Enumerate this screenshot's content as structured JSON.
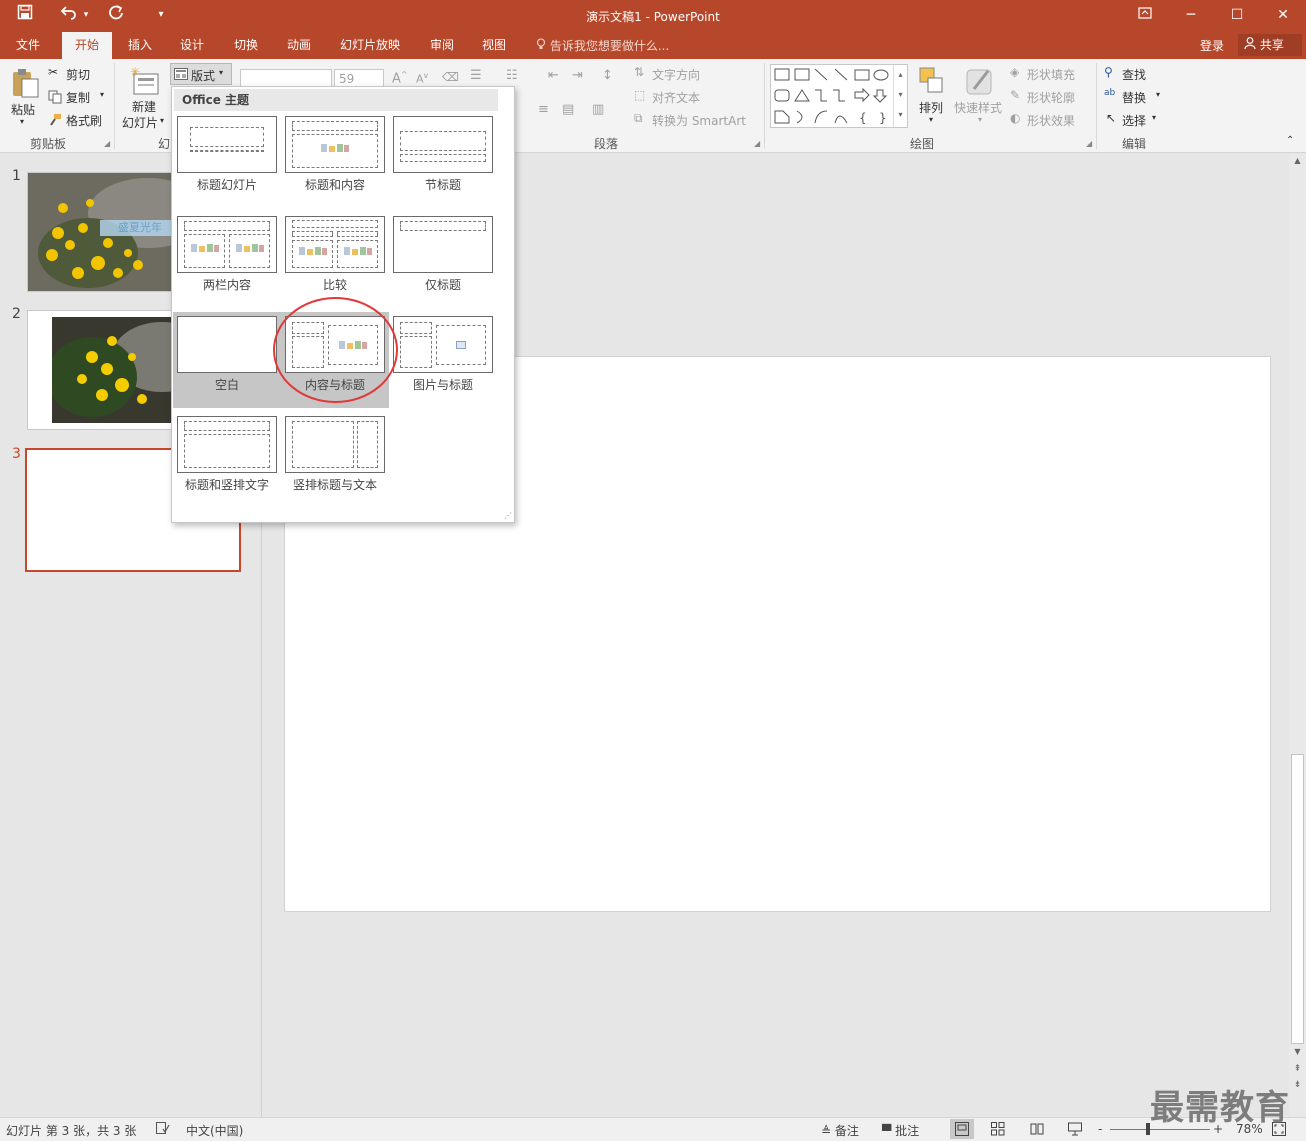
{
  "title_bar": {
    "title": "演示文稿1 - PowerPoint",
    "save_icon": "save-icon",
    "undo_icon": "undo-icon",
    "redo_icon": "redo-icon",
    "customize_icon": "customize-quick-access-icon",
    "ribbon_display_icon": "ribbon-display-options-icon",
    "minimize": "─",
    "maximize": "☐",
    "close": "✕"
  },
  "tabs": [
    "文件",
    "开始",
    "插入",
    "设计",
    "切换",
    "动画",
    "幻灯片放映",
    "审阅",
    "视图"
  ],
  "active_tab": "开始",
  "tell_me": "告诉我您想要做什么...",
  "login": "登录",
  "share": "共享",
  "ribbon": {
    "clipboard": {
      "paste": "粘贴",
      "cut": "剪切",
      "copy": "复制",
      "format_painter": "格式刷",
      "group": "剪贴板"
    },
    "slides": {
      "new_slide_1": "新建",
      "new_slide_2": "幻灯片",
      "layout": "版式",
      "group_partial": "幻"
    },
    "font": {
      "size": "59"
    },
    "paragraph": {
      "text_direction": "文字方向",
      "align_text": "对齐文本",
      "smartart": "转换为 SmartArt",
      "group": "段落"
    },
    "drawing": {
      "arrange": "排列",
      "quick_styles": "快速样式",
      "shape_fill": "形状填充",
      "shape_outline": "形状轮廓",
      "shape_effects": "形状效果",
      "group": "绘图"
    },
    "editing": {
      "find": "查找",
      "replace": "替换",
      "select": "选择",
      "group": "编辑"
    }
  },
  "layout_dropdown": {
    "header": "Office 主题",
    "layouts": [
      "标题幻灯片",
      "标题和内容",
      "节标题",
      "两栏内容",
      "比较",
      "仅标题",
      "空白",
      "内容与标题",
      "图片与标题",
      "标题和竖排文字",
      "竖排标题与文本"
    ],
    "highlighted": "内容与标题"
  },
  "thumbnails": [
    {
      "number": "1",
      "caption": "盛夏光年"
    },
    {
      "number": "2"
    },
    {
      "number": "3"
    }
  ],
  "status": {
    "slide_info": "幻灯片 第 3 张，共 3 张",
    "language": "中文(中国)",
    "notes": "备注",
    "comments": "批注",
    "zoom_minus": "-",
    "zoom_plus": "+",
    "zoom": "78%"
  },
  "watermark": "最需教育",
  "colors": {
    "accent": "#b7472a",
    "highlight_circle": "#e0393a",
    "selected_thumb": "#c8462a"
  }
}
